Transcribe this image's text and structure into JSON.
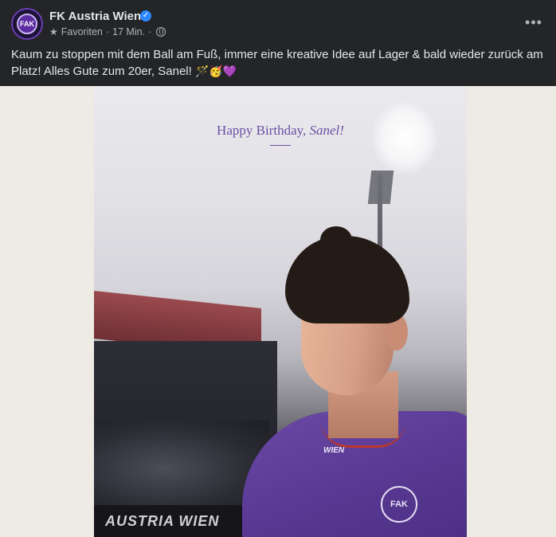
{
  "post": {
    "page_name": "FK Austria Wien",
    "audience_label": "Favoriten",
    "separator": "·",
    "timestamp": "17 Min.",
    "verified_icon": "verified-badge-icon",
    "more_icon": "more-options-icon",
    "text": "Kaum zu stoppen mit dem Ball am Fuß, immer eine kreative Idee auf Lager & bald wieder zurück am Platz! Alles Gute zum 20er, Sanel!",
    "emojis": [
      "🪄",
      "🥳",
      "💜"
    ]
  },
  "image": {
    "greeting_prefix": "Happy Birthday, ",
    "greeting_name": "Sanel!",
    "board_text": "AUSTRIA WIEN",
    "sponsor_text": "WIEN",
    "crest_text": "FAK"
  },
  "colors": {
    "background": "#242526",
    "text_primary": "#e4e6eb",
    "text_secondary": "#b0b3b8",
    "verified": "#2d88ff",
    "accent_purple": "#6a4fa3",
    "jersey": "#5a3a94"
  }
}
